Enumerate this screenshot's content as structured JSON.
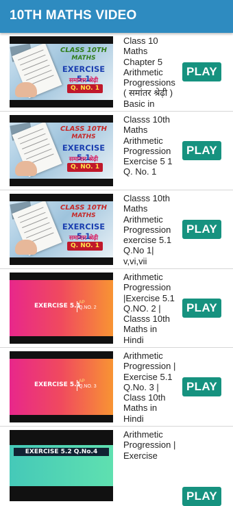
{
  "app": {
    "title": "10TH MATHS VIDEO"
  },
  "play_label": "PLAY",
  "videos": [
    {
      "title": "Class 10 Maths Chapter 5 Arithmetic Progressions ( समांतर श्रेढ़ी ) Basic  in",
      "thumb": {
        "line1": "CLASS 10TH",
        "line2": "MATHS",
        "line3": "EXERCISE 5.1",
        "line4": "समान्तर श्रेढ़ी",
        "line5": "Q. NO. 1"
      }
    },
    {
      "title": "Classs 10th Maths Arithmetic Progression Exercise 5 1 Q. No.  1",
      "thumb": {
        "line1": "CLASS 10TH",
        "line2": "MATHS",
        "line3": "EXERCISE 5.1",
        "line4": "समान्तर श्रेढ़ी",
        "line5": "Q. NO. 1"
      }
    },
    {
      "title": "Classs 10th Maths Arithmetic Progression exercise 5.1 Q.No 1| v,vi,vii",
      "thumb": {
        "line1": "CLASS 10TH",
        "line2": "MATHS",
        "line3": "EXERCISE 5.1",
        "line4": "समान्तर श्रेढ़ी",
        "line5": "Q. NO. 1"
      }
    },
    {
      "title": "Arithmetic Progression |Exercise 5.1 Q.NO.  2 | Classs 10th Maths in Hindi",
      "thumb": {
        "exercise": "EXERCISE 5.1",
        "ap": "AP",
        "qno": "Q.NO. 2"
      }
    },
    {
      "title": "Arithmetic Progression | Exercise 5.1 Q.No. 3 | Class 10th Maths in Hindi",
      "thumb": {
        "exercise": "EXERCISE 5.1",
        "ap": "AP",
        "qno": "Q.NO. 3"
      }
    },
    {
      "title": "Arithmetic Progression | Exercise",
      "thumb": {
        "band": "EXERCISE 5.2 Q.No.4"
      }
    }
  ]
}
